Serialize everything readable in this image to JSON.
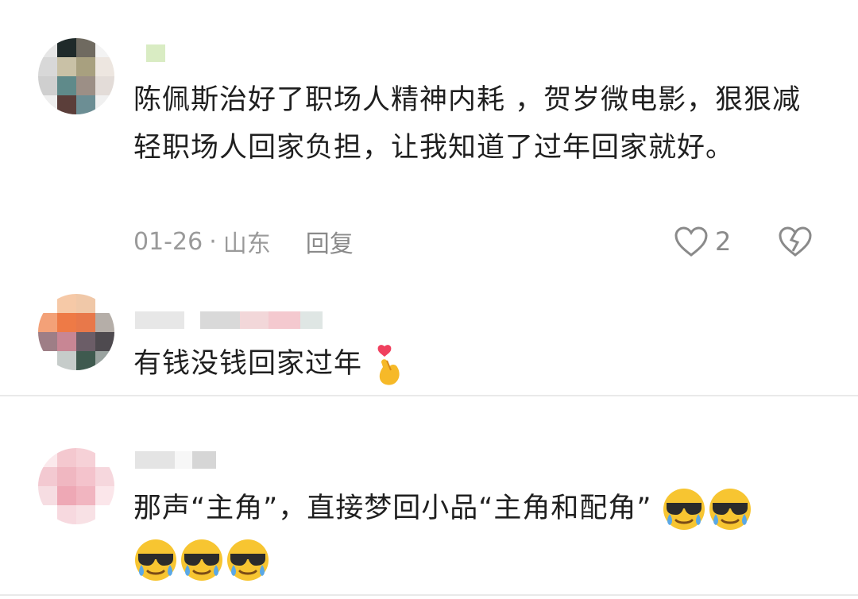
{
  "comments": [
    {
      "text": "陈佩斯治好了职场人精神内耗 ，贺岁微电影，狠狠减轻职场人回家负担，让我知道了过年回家就好。",
      "date": "01-26",
      "separator": "·",
      "location": "山东",
      "reply_label": "回复",
      "like_count": "2",
      "like_icon": "heart-outline-icon",
      "dislike_icon": "broken-heart-icon"
    },
    {
      "text": "有钱没钱回家过年",
      "emoji": "finger-heart-emoji"
    },
    {
      "text": "那声“主角”，直接梦回小品“主角和配角”",
      "emoji": "cool-crying-face-emoji",
      "emoji_count": 5
    }
  ],
  "colors": {
    "text": "#1f1f1f",
    "meta": "#9a9a9a",
    "divider": "#e9e9e9"
  }
}
